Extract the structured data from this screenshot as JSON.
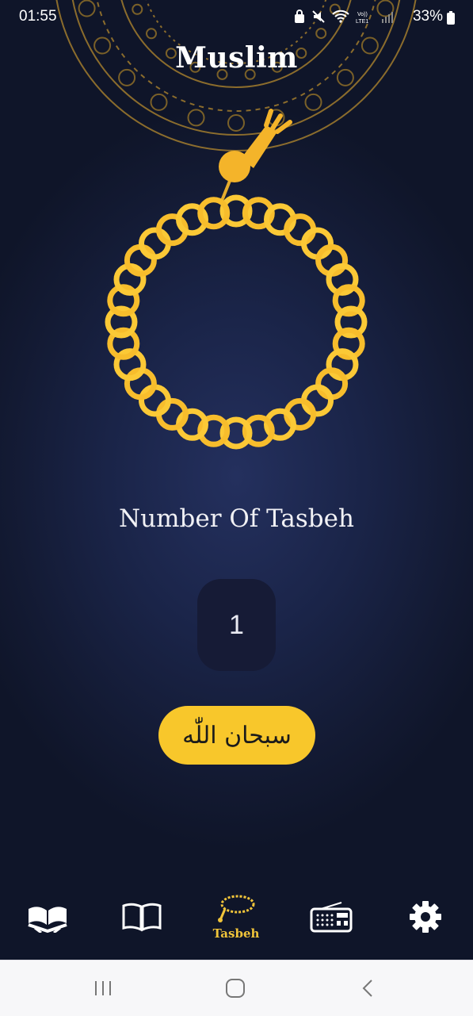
{
  "status_bar": {
    "time": "01:55",
    "battery": "33%"
  },
  "app": {
    "title": "Muslim"
  },
  "main": {
    "label": "Number Of Tasbeh",
    "count": "1",
    "zikr_button": "سبحان اللّٰه"
  },
  "bottom_nav": {
    "items": [
      {
        "icon": "quran-icon",
        "label": ""
      },
      {
        "icon": "book-icon",
        "label": ""
      },
      {
        "icon": "tasbeh-icon",
        "label": "Tasbeh",
        "active": true
      },
      {
        "icon": "radio-icon",
        "label": ""
      },
      {
        "icon": "settings-icon",
        "label": ""
      }
    ]
  },
  "colors": {
    "accent": "#f8c72b",
    "background": "#1a2448",
    "nav_bg": "#0f1529",
    "counter_bg": "#161b36"
  }
}
